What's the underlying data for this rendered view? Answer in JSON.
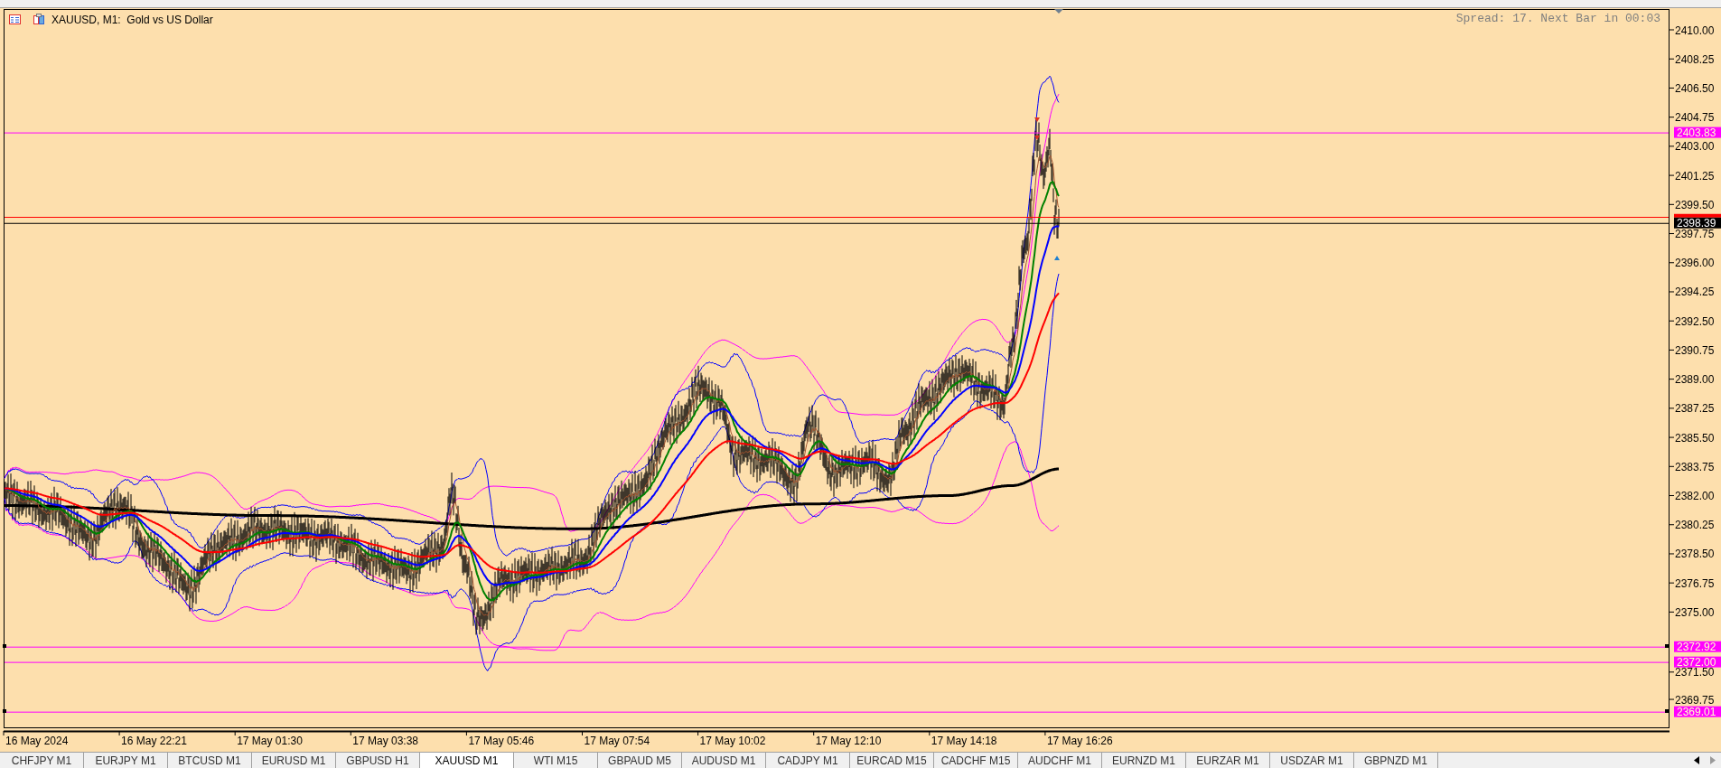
{
  "chart": {
    "title": "XAUUSD, M1:  Gold vs US Dollar",
    "info": "Spread: 17. Next Bar in 00:03",
    "y_axis": [
      "2410.00",
      "2408.25",
      "2406.50",
      "2404.75",
      "2403.00",
      "2401.25",
      "2399.50",
      "2397.75",
      "2396.00",
      "2394.25",
      "2392.50",
      "2390.75",
      "2389.00",
      "2387.25",
      "2385.50",
      "2383.75",
      "2382.00",
      "2380.25",
      "2378.50",
      "2376.75",
      "2375.00",
      "2371.50",
      "2369.75"
    ],
    "price_tags": [
      {
        "text": "2403.83",
        "color": "#ff00ff"
      },
      {
        "text": "2398.39",
        "color": "#000000"
      },
      {
        "text": "2372.92",
        "color": "#ff00ff"
      },
      {
        "text": "2372.00",
        "color": "#ff00ff"
      },
      {
        "text": "2369.01",
        "color": "#ff00ff"
      }
    ],
    "x_axis": [
      "16 May 2024",
      "16 May 22:21",
      "17 May 01:30",
      "17 May 03:38",
      "17 May 05:46",
      "17 May 07:54",
      "17 May 10:02",
      "17 May 12:10",
      "17 May 14:18",
      "17 May 16:26"
    ]
  },
  "tabs": [
    {
      "label": "CHFJPY M1",
      "selected": false
    },
    {
      "label": "EURJPY M1",
      "selected": false
    },
    {
      "label": "BTCUSD M1",
      "selected": false
    },
    {
      "label": "EURUSD M1",
      "selected": false
    },
    {
      "label": "GBPUSD H1",
      "selected": false
    },
    {
      "label": "XAUUSD M1",
      "selected": true
    },
    {
      "label": "WTI M15",
      "selected": false
    },
    {
      "label": "GBPAUD M5",
      "selected": false
    },
    {
      "label": "AUDUSD M1",
      "selected": false
    },
    {
      "label": "CADJPY M1",
      "selected": false
    },
    {
      "label": "EURCAD M15",
      "selected": false
    },
    {
      "label": "CADCHF M15",
      "selected": false
    },
    {
      "label": "AUDCHF M1",
      "selected": false
    },
    {
      "label": "EURNZD M1",
      "selected": false
    },
    {
      "label": "EURZAR M1",
      "selected": false
    },
    {
      "label": "USDZAR M1",
      "selected": false
    },
    {
      "label": "GBPNZD M1",
      "selected": false
    }
  ]
}
